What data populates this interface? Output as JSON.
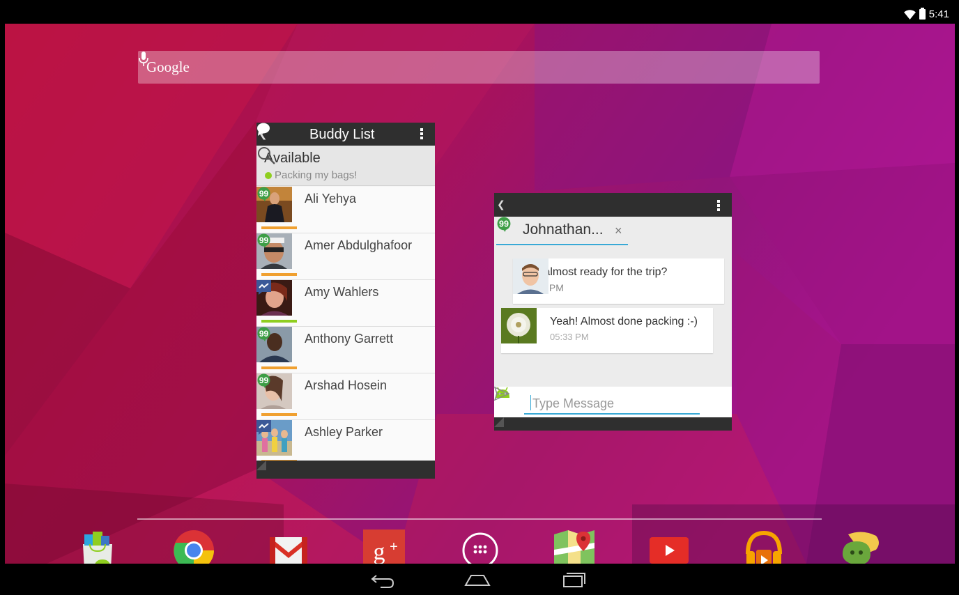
{
  "status_bar": {
    "time": "5:41"
  },
  "search_bar": {
    "label": "Google"
  },
  "buddy_list": {
    "title": "Buddy List",
    "status_label": "Available",
    "status_message": "Packing my bags!",
    "buddies": [
      {
        "name": "Ali Yehya",
        "service": "hangouts",
        "bar_color": "#f0a030"
      },
      {
        "name": "Amer Abdulghafoor",
        "service": "hangouts",
        "bar_color": "#f0a030"
      },
      {
        "name": "Amy Wahlers",
        "service": "messenger",
        "bar_color": "#8fce1f"
      },
      {
        "name": "Anthony Garrett",
        "service": "hangouts",
        "bar_color": "#f0a030"
      },
      {
        "name": "Arshad Hosein",
        "service": "hangouts",
        "bar_color": "#f0a030"
      },
      {
        "name": "Ashley Parker",
        "service": "messenger",
        "bar_color": "#f0a030"
      }
    ]
  },
  "chat": {
    "tab_name": "Johnathan...",
    "tab_close": "×",
    "messages": [
      {
        "text": "You almost ready for the trip?",
        "time": "05:32 PM"
      },
      {
        "text": "Yeah! Almost done packing :-)",
        "time": "05:33 PM"
      }
    ],
    "input_placeholder": "Type Message"
  },
  "dock": {
    "apps": [
      "play-store",
      "chrome",
      "gmail",
      "google-plus",
      "app-drawer",
      "maps",
      "youtube",
      "play-music",
      "im-app"
    ]
  },
  "colors": {
    "accent": "#39a9d6",
    "hangouts_green": "#3d9e46",
    "online_green": "#8fce1f"
  }
}
